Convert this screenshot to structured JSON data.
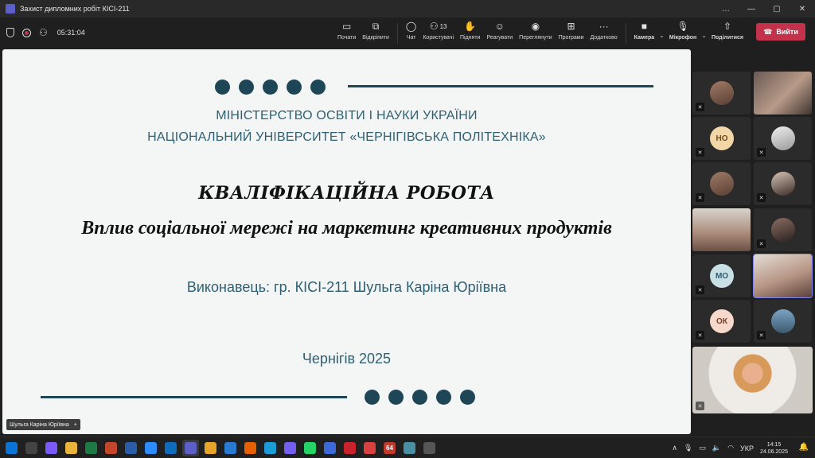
{
  "window": {
    "title": "Захист дипломних робіт КІСІ-211",
    "controls": [
      "…",
      "—",
      "▢",
      "✕"
    ]
  },
  "toolbar": {
    "timer": "05:31:04",
    "items": [
      {
        "id": "start",
        "label": "Почати",
        "icon": "monitor-icon"
      },
      {
        "id": "detach",
        "label": "Відкріпити",
        "icon": "detach-icon"
      },
      {
        "id": "chat",
        "label": "Чат",
        "icon": "chat-icon"
      },
      {
        "id": "people",
        "label": "Користувачі",
        "icon": "people-icon",
        "count": "13"
      },
      {
        "id": "raise",
        "label": "Підняти",
        "icon": "hand-icon"
      },
      {
        "id": "react",
        "label": "Реагувати",
        "icon": "smile-icon"
      },
      {
        "id": "view",
        "label": "Переглянути",
        "icon": "view-icon"
      },
      {
        "id": "apps",
        "label": "Програми",
        "icon": "apps-icon"
      },
      {
        "id": "more",
        "label": "Додатково",
        "icon": "more-icon"
      }
    ],
    "camera": "Камера",
    "mic": "Мікрофон",
    "share": "Поділитися",
    "leave": "Вийти"
  },
  "slide": {
    "ministry": "МІНІСТЕРСТВО ОСВІТИ І НАУКИ УКРАЇНИ",
    "university": "НАЦІОНАЛЬНИЙ УНІВЕРСИТЕТ «ЧЕРНІГІВСЬКА ПОЛІТЕХНІКА»",
    "work_title": "КВАЛІФІКАЦІЙНА РОБОТА",
    "topic": "Вплив соціальної мережі на маркетинг креативних продуктів",
    "author": "Виконавець: гр. КІСІ-211 Шульга Каріна Юріївна",
    "city_year": "Чернігів 2025"
  },
  "presenter": {
    "name": "Шульга Каріна Юріївна"
  },
  "participants": [
    {
      "type": "photo"
    },
    {
      "type": "video"
    },
    {
      "type": "initials",
      "initials": "НО",
      "color": "#f4d7a8"
    },
    {
      "type": "photo"
    },
    {
      "type": "photo"
    },
    {
      "type": "photo"
    },
    {
      "type": "video"
    },
    {
      "type": "photo"
    },
    {
      "type": "initials",
      "initials": "МО",
      "color": "#c8dfe6"
    },
    {
      "type": "video",
      "active": true
    },
    {
      "type": "initials",
      "initials": "ОК",
      "color": "#f7d9cc"
    },
    {
      "type": "photo"
    },
    {
      "type": "video"
    }
  ],
  "taskbar": {
    "apps": [
      {
        "name": "start-icon",
        "color": "#0b74d7"
      },
      {
        "name": "settings-icon",
        "color": "#444"
      },
      {
        "name": "copilot-icon",
        "color": "#7a5af8"
      },
      {
        "name": "file-explorer-icon",
        "color": "#e8b43a"
      },
      {
        "name": "excel-icon",
        "color": "#1d7a45"
      },
      {
        "name": "powerpoint-icon",
        "color": "#c5472b"
      },
      {
        "name": "word-icon",
        "color": "#2b5ca8"
      },
      {
        "name": "zoom-icon",
        "color": "#2d8cff"
      },
      {
        "name": "outlook-icon",
        "color": "#0f6cbd"
      },
      {
        "name": "teams-icon",
        "color": "#5b5fc7"
      },
      {
        "name": "chrome-icon",
        "color": "#e6a42b"
      },
      {
        "name": "photos-icon",
        "color": "#2a7ad2"
      },
      {
        "name": "firefox-icon",
        "color": "#e66000"
      },
      {
        "name": "edge-icon",
        "color": "#1d9bd7"
      },
      {
        "name": "viber-icon",
        "color": "#7360f2"
      },
      {
        "name": "whatsapp-icon",
        "color": "#25d366"
      },
      {
        "name": "save-icon",
        "color": "#3c6ad8"
      },
      {
        "name": "acrobat-icon",
        "color": "#c8232c"
      },
      {
        "name": "anydesk-icon",
        "color": "#d94141"
      },
      {
        "name": "app64-icon",
        "color": "#c0392b",
        "text": "64"
      },
      {
        "name": "paint-icon",
        "color": "#4a90a4"
      },
      {
        "name": "calculator-icon",
        "color": "#555"
      }
    ],
    "lang": "УКР",
    "time": "14:15",
    "date": "24.06.2025"
  }
}
